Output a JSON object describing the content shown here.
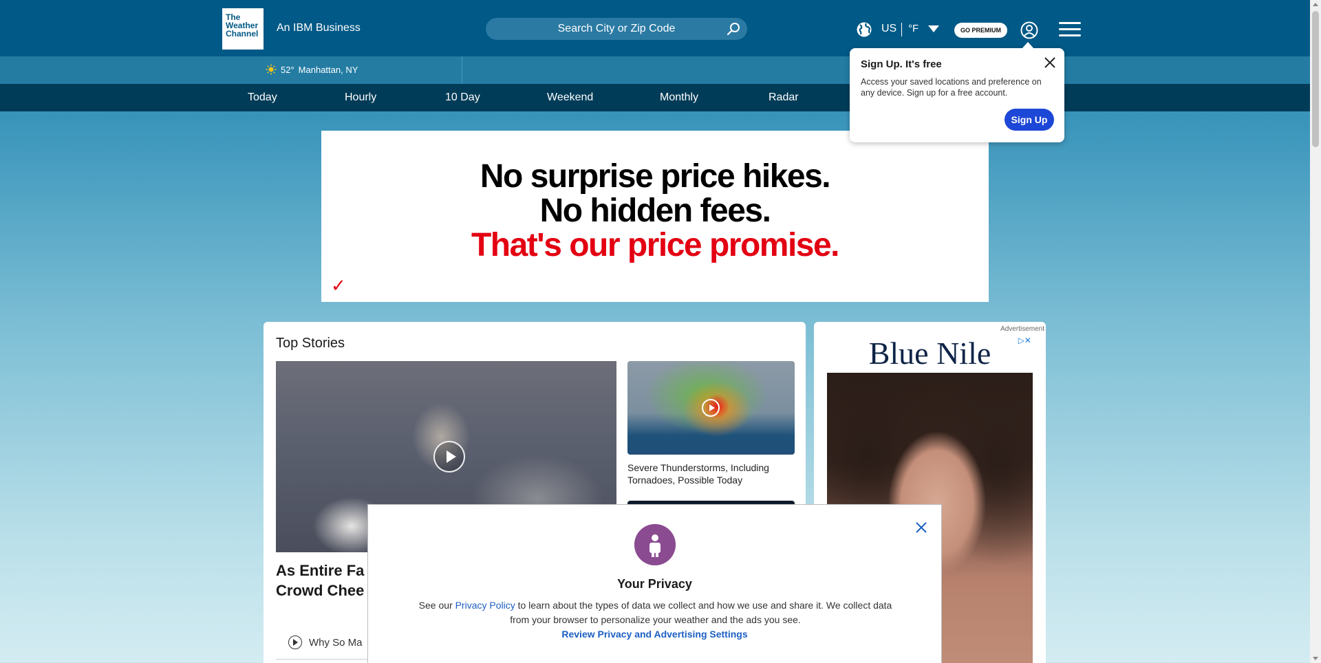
{
  "header": {
    "logo_lines": [
      "The",
      "Weather",
      "Channel"
    ],
    "tagline": "An IBM Business",
    "search_placeholder": "Search City or Zip Code",
    "locale": "US",
    "unit": "°F",
    "premium_label": "GO PREMIUM"
  },
  "location_bar": {
    "temperature": "52°",
    "city": "Manhattan, NY"
  },
  "nav": {
    "items": [
      "Today",
      "Hourly",
      "10 Day",
      "Weekend",
      "Monthly",
      "Radar"
    ]
  },
  "ad_banner": {
    "line1": "No surprise price hikes.",
    "line2": "No hidden fees.",
    "line3": "That's our price promise.",
    "check": "✓"
  },
  "main": {
    "section_title": "Top Stories",
    "featured_headline_line1": "As Entire Fa",
    "featured_headline_line2": "Crowd Chee",
    "video_row_label": "Why So Ma",
    "side_story_title": "Severe Thunderstorms, Including Tornadoes, Possible Today"
  },
  "side_ad": {
    "label": "Advertisement",
    "brand": "Blue Nile",
    "adchoices": "▷✕"
  },
  "signup_popup": {
    "title": "Sign Up. It's free",
    "body": "Access your saved locations and preference on any device. Sign up for a free account.",
    "button_label": "Sign Up"
  },
  "privacy_modal": {
    "title": "Your Privacy",
    "text_before_link": "See our ",
    "link_text": "Privacy Policy",
    "text_after_link": " to learn about the types of data we collect and how we use and share it. We collect data from your browser to personalize your weather and the ads you see.",
    "review_link": "Review Privacy and Advertising Settings"
  },
  "colors": {
    "header_bg": "#005986",
    "nav_bg": "#003c58",
    "signup_button": "#1d47d6",
    "ad_red": "#e30012",
    "link_blue": "#1b5fc1"
  },
  "icons": [
    "globe-icon",
    "search-icon",
    "user-icon",
    "hamburger-menu-icon",
    "sun-icon",
    "close-icon",
    "play-icon",
    "privacy-person-icon"
  ]
}
